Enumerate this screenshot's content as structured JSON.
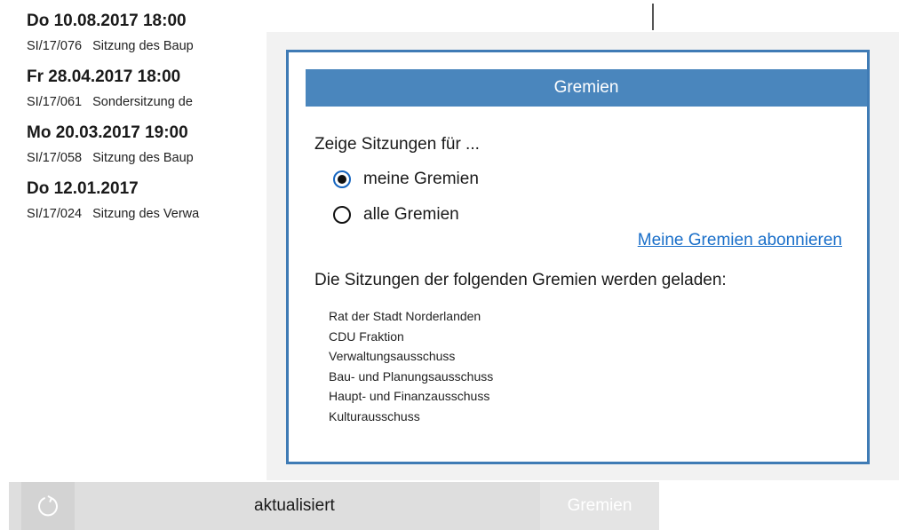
{
  "meetings": [
    {
      "date": "Do 10.08.2017 18:00",
      "code": "SI/17/076",
      "title": "Sitzung des Baup"
    },
    {
      "date": "Fr 28.04.2017 18:00",
      "code": "SI/17/061",
      "title": "Sondersitzung de"
    },
    {
      "date": "Mo 20.03.2017 19:00",
      "code": "SI/17/058",
      "title": "Sitzung des Baup"
    },
    {
      "date": "Do 12.01.2017",
      "code": "SI/17/024",
      "title": "Sitzung des Verwa"
    }
  ],
  "flyout": {
    "header": "Gremien",
    "show_label": "Zeige Sitzungen für ...",
    "options": [
      {
        "label": "meine Gremien",
        "checked": true
      },
      {
        "label": "alle Gremien",
        "checked": false
      }
    ],
    "subscribe_link": "Meine Gremien abonnieren",
    "loaded_heading": "Die Sitzungen der folgenden Gremien werden geladen:",
    "gremien": [
      "Rat der Stadt Norderlanden",
      "CDU Fraktion",
      "Verwaltungsausschuss",
      "Bau- und Planungsausschuss",
      "Haupt- und Finanzausschuss",
      "Kulturausschuss"
    ],
    "accent_color": "#4a86bd",
    "border_color": "#3f7bb5"
  },
  "bottom_bar": {
    "refresh_icon": "refresh-icon",
    "status": "aktualisiert",
    "gremien_button": "Gremien"
  }
}
